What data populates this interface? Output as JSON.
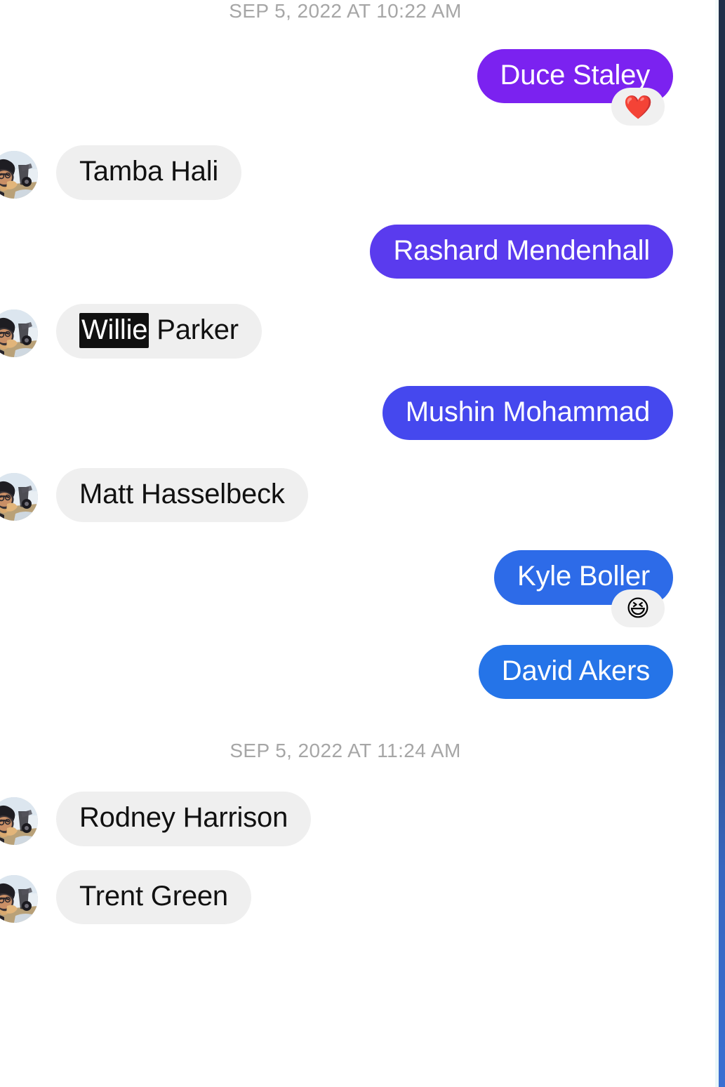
{
  "app": {
    "background_color": "#ffffff",
    "edge_strip_colors": [
      "#21304a",
      "#3a6fd2"
    ]
  },
  "colors": {
    "received_bubble": "#efefef",
    "received_text": "#111111",
    "date_text": "#a6a6a6",
    "reaction_pill": "#f0f0f0",
    "highlight_bg": "#111111",
    "highlight_text": "#ffffff"
  },
  "conversation": {
    "separators": {
      "first": "SEP 5, 2022 AT 10:22 AM",
      "second": "SEP 5, 2022 AT 11:24 AM"
    },
    "messages": [
      {
        "id": "m1",
        "text": "Duce Staley",
        "direction": "outgoing",
        "bubble_color": "#7b22f0",
        "reaction": "❤️",
        "reaction_name": "heart-reaction"
      },
      {
        "id": "m2",
        "text": "Tamba Hali",
        "direction": "incoming",
        "bubble_color": "#efefef",
        "avatar": "contact-photo"
      },
      {
        "id": "m3",
        "text": "Rashard Mendenhall",
        "direction": "outgoing",
        "bubble_color": "#5a3bee"
      },
      {
        "id": "m4",
        "text_highlighted": "Willie",
        "text_rest": " Parker",
        "direction": "incoming",
        "bubble_color": "#efefef",
        "avatar": "contact-photo"
      },
      {
        "id": "m5",
        "text": "Mushin Mohammad",
        "direction": "outgoing",
        "bubble_color": "#4548ee"
      },
      {
        "id": "m6",
        "text": "Matt Hasselbeck",
        "direction": "incoming",
        "bubble_color": "#efefef",
        "avatar": "contact-photo"
      },
      {
        "id": "m7",
        "text": "Kyle Boller",
        "direction": "outgoing",
        "bubble_color": "#2d6be8",
        "reaction": "😆",
        "reaction_name": "laughing-reaction"
      },
      {
        "id": "m8",
        "text": "David Akers",
        "direction": "outgoing",
        "bubble_color": "#2574e8"
      },
      {
        "id": "m9",
        "text": "Rodney Harrison",
        "direction": "incoming",
        "bubble_color": "#efefef",
        "avatar": "contact-photo"
      },
      {
        "id": "m10",
        "text": "Trent Green",
        "direction": "incoming",
        "bubble_color": "#efefef",
        "avatar": "contact-photo"
      }
    ]
  }
}
